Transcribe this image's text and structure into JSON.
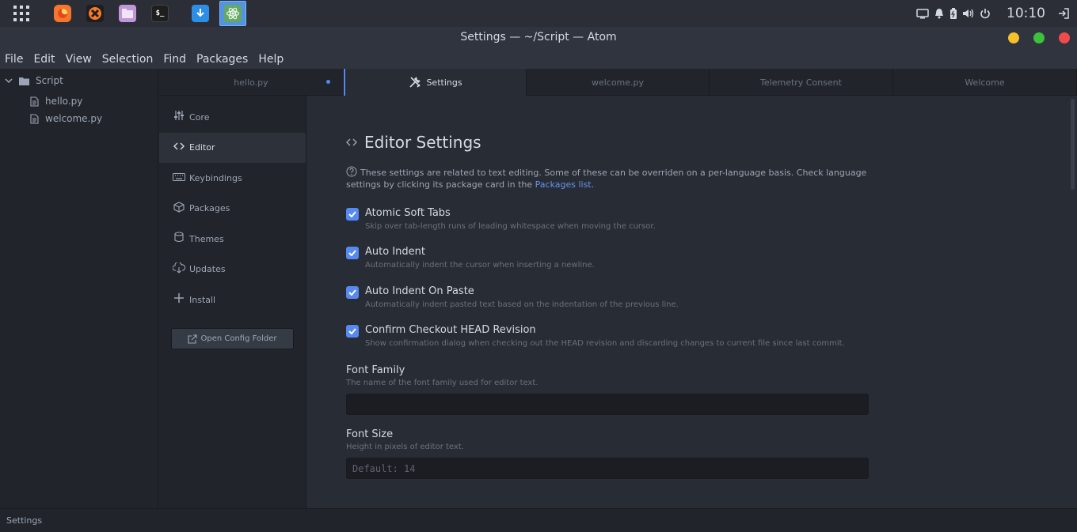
{
  "taskbar": {
    "apps": [
      {
        "name": "app-grid",
        "color": "#2b2e37"
      },
      {
        "name": "firefox",
        "color": "#f4772b"
      },
      {
        "name": "xampp",
        "color": "#fb7a24"
      },
      {
        "name": "files",
        "color": "#c197d8"
      },
      {
        "name": "terminal",
        "color": "#1e1e1e"
      },
      {
        "name": "downloader",
        "color": "#2d8ee6"
      },
      {
        "name": "atom",
        "color": "#66a765"
      }
    ],
    "clock": "10:10"
  },
  "window": {
    "title": "Settings — ~/Script — Atom",
    "buttons": {
      "minimize": "#f5c02a",
      "maximize": "#3dc13d",
      "close": "#f04a4a"
    }
  },
  "menubar": [
    "File",
    "Edit",
    "View",
    "Selection",
    "Find",
    "Packages",
    "Help"
  ],
  "tree": {
    "root": "Script",
    "files": [
      "hello.py",
      "welcome.py"
    ]
  },
  "tabs": [
    {
      "label": "hello.py",
      "modified": true
    },
    {
      "label": "Settings",
      "active": true
    },
    {
      "label": "welcome.py"
    },
    {
      "label": "Telemetry Consent"
    },
    {
      "label": "Welcome"
    }
  ],
  "settings_menu": {
    "items": [
      {
        "label": "Core",
        "icon": "sliders-icon"
      },
      {
        "label": "Editor",
        "icon": "code-icon",
        "selected": true
      },
      {
        "label": "Keybindings",
        "icon": "keyboard-icon"
      },
      {
        "label": "Packages",
        "icon": "package-icon"
      },
      {
        "label": "Themes",
        "icon": "paintcan-icon"
      },
      {
        "label": "Updates",
        "icon": "cloud-download-icon"
      },
      {
        "label": "Install",
        "icon": "plus-icon"
      }
    ],
    "open_config": "Open Config Folder"
  },
  "editor_settings": {
    "title": "Editor Settings",
    "description_part1": "These settings are related to text editing. Some of these can be overriden on a per-language basis. Check language settings by clicking its package card in the ",
    "description_link": "Packages list",
    "description_part2": ".",
    "checkboxes": [
      {
        "title": "Atomic Soft Tabs",
        "description": "Skip over tab-length runs of leading whitespace when moving the cursor.",
        "checked": true
      },
      {
        "title": "Auto Indent",
        "description": "Automatically indent the cursor when inserting a newline.",
        "checked": true
      },
      {
        "title": "Auto Indent On Paste",
        "description": "Automatically indent pasted text based on the indentation of the previous line.",
        "checked": true
      },
      {
        "title": "Confirm Checkout HEAD Revision",
        "description": "Show confirmation dialog when checking out the HEAD revision and discarding changes to current file since last commit.",
        "checked": true
      }
    ],
    "font_family": {
      "title": "Font Family",
      "description": "The name of the font family used for editor text.",
      "value": ""
    },
    "font_size": {
      "title": "Font Size",
      "description": "Height in pixels of editor text.",
      "placeholder": "Default: 14"
    }
  },
  "statusbar": {
    "text": "Settings"
  }
}
